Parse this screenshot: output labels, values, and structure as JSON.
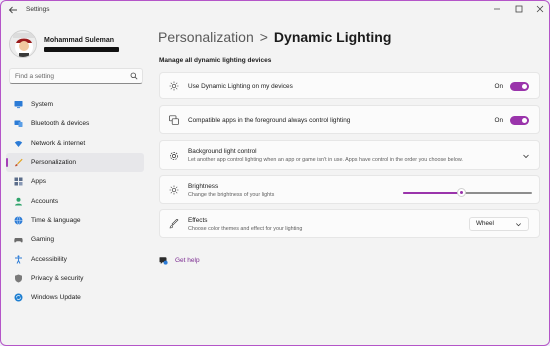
{
  "window": {
    "title": "Settings"
  },
  "profile": {
    "name": "Mohammad Suleman"
  },
  "search": {
    "placeholder": "Find a setting"
  },
  "sidebar": {
    "items": [
      {
        "label": "System",
        "icon": "monitor-icon"
      },
      {
        "label": "Bluetooth & devices",
        "icon": "bluetooth-icon"
      },
      {
        "label": "Network & internet",
        "icon": "wifi-icon"
      },
      {
        "label": "Personalization",
        "icon": "brush-icon",
        "active": true
      },
      {
        "label": "Apps",
        "icon": "apps-icon"
      },
      {
        "label": "Accounts",
        "icon": "person-icon"
      },
      {
        "label": "Time & language",
        "icon": "globe-icon"
      },
      {
        "label": "Gaming",
        "icon": "gamepad-icon"
      },
      {
        "label": "Accessibility",
        "icon": "accessibility-icon"
      },
      {
        "label": "Privacy & security",
        "icon": "shield-icon"
      },
      {
        "label": "Windows Update",
        "icon": "update-icon"
      }
    ]
  },
  "header": {
    "parent": "Personalization",
    "separator": ">",
    "current": "Dynamic Lighting"
  },
  "section": {
    "title": "Manage all dynamic lighting devices"
  },
  "settings": {
    "use_dynamic": {
      "title": "Use Dynamic Lighting on my devices",
      "state_label": "On",
      "on": true
    },
    "compatible_apps": {
      "title": "Compatible apps in the foreground always control lighting",
      "state_label": "On",
      "on": true
    },
    "background_control": {
      "title": "Background light control",
      "desc": "Let another app control lighting when an app or game isn't in use. Apps have control in the order you choose below."
    },
    "brightness": {
      "title": "Brightness",
      "desc": "Change the brightness of your lights",
      "level": 0.45
    },
    "effects": {
      "title": "Effects",
      "desc": "Choose color themes and effect for your lighting",
      "selected": "Wheel"
    }
  },
  "help": {
    "label": "Get help"
  },
  "colors": {
    "accent": "#9a34ab",
    "active_indicator": "#a43fb7",
    "link": "#7b2b90"
  }
}
